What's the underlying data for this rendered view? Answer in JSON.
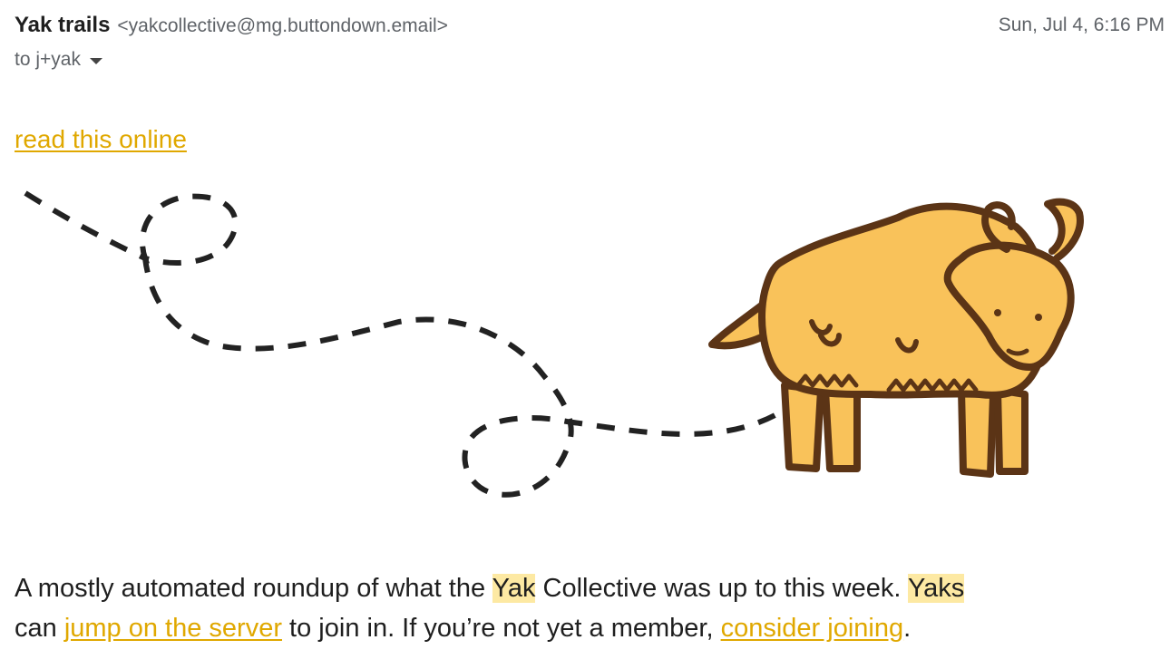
{
  "header": {
    "sender_name": "Yak trails",
    "sender_email": "<yakcollective@mg.buttondown.email>",
    "date": "Sun, Jul 4, 6:16 PM",
    "recipient": "to j+yak"
  },
  "email": {
    "read_online_link": "read this online",
    "illustration": "yak-with-dashed-trail",
    "body": {
      "part1": "A mostly automated roundup of what the ",
      "highlight1": "Yak",
      "part2": " Collective was up to this week. ",
      "highlight2": "Yaks",
      "part3": " can ",
      "link1": "jump on the server",
      "part4": " to join in. If you’re not yet a member, ",
      "link2": "consider joining",
      "part5": "."
    }
  },
  "colors": {
    "link": "#e0a800",
    "highlight": "#fde9a3",
    "yak_fill": "#f9c25a",
    "yak_outline": "#5b3416",
    "trail": "#222222"
  }
}
